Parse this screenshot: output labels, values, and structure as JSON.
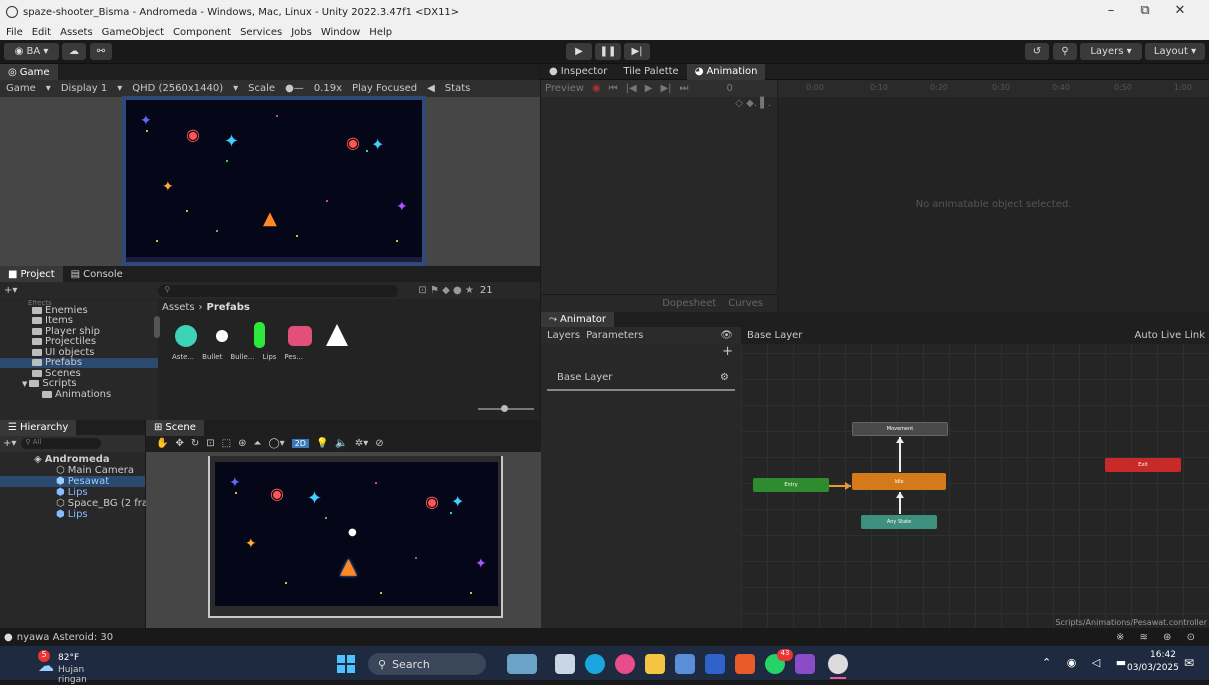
{
  "window": {
    "title": "spaze-shooter_Bisma - Andromeda - Windows, Mac, Linux - Unity 2022.3.47f1 <DX11>"
  },
  "menu": [
    "File",
    "Edit",
    "Assets",
    "GameObject",
    "Component",
    "Services",
    "Jobs",
    "Window",
    "Help"
  ],
  "toolbar": {
    "account": "BA",
    "layers": "Layers",
    "layout": "Layout"
  },
  "game": {
    "tab": "Game",
    "mode": "Game",
    "display": "Display 1",
    "resolution": "QHD (2560x1440)",
    "scale_label": "Scale",
    "scale_value": "0.19x",
    "play_focused": "Play Focused",
    "stats": "Stats"
  },
  "inspector_tabs": [
    "Inspector",
    "Tile Palette",
    "Animation"
  ],
  "animation": {
    "preview": "Preview",
    "frame": "0",
    "ticks": [
      "0:00",
      "0:10",
      "0:20",
      "0:30",
      "0:40",
      "0:50",
      "1:00"
    ],
    "empty": "No animatable object selected.",
    "dopesheet": "Dopesheet",
    "curves": "Curves"
  },
  "project": {
    "tab": "Project",
    "console_tab": "Console",
    "breadcrumb_root": "Assets",
    "breadcrumb_leaf": "Prefabs",
    "count": "21",
    "folders": [
      "Enemies",
      "Items",
      "Player ship",
      "Projectiles",
      "UI objects",
      "Prefabs",
      "Scenes",
      "Scripts",
      "Animations"
    ],
    "assets": [
      "Aste...",
      "Bullet",
      "Bulle...",
      "Lips",
      "Pes..."
    ]
  },
  "hierarchy": {
    "tab": "Hierarchy",
    "search": "All",
    "scene": "Andromeda",
    "items": [
      "Main Camera",
      "Pesawat",
      "Lips",
      "Space_BG (2 fra",
      "Lips"
    ]
  },
  "scene": {
    "tab": "Scene",
    "mode2d": "2D"
  },
  "animator": {
    "tab": "Animator",
    "layers_tab": "Layers",
    "params_tab": "Parameters",
    "base_layer": "Base Layer",
    "breadcrumb": "Base Layer",
    "auto_live": "Auto Live Link",
    "states": {
      "movement": "Movement",
      "idle": "Idle",
      "entry": "Entry",
      "any": "Any State",
      "exit": "Exit"
    },
    "path": "Scripts/Animations/Pesawat.controller"
  },
  "status": {
    "message": "nyawa Asteroid: 30"
  },
  "taskbar": {
    "weather_temp": "82°F",
    "weather_desc": "Hujan ringan",
    "search": "Search",
    "time": "16:42",
    "date": "03/03/2025",
    "badge_weather": "5",
    "badge_whatsapp": "43"
  },
  "colors": {
    "entry": "#2e8b2e",
    "idle": "#d47a1a",
    "any": "#3f8f7f",
    "exit": "#c82a2a",
    "movement": "#4a4a4a",
    "accent": "#3a79bb"
  }
}
